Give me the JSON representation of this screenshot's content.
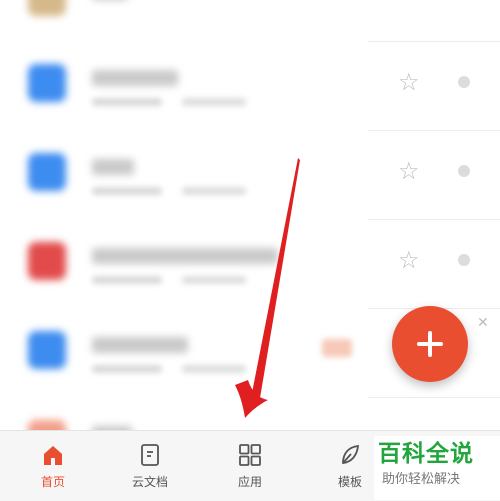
{
  "rows": [
    {
      "icon_color": "#a8a8a8",
      "starred": false
    },
    {
      "icon_color": "#3d8cf0",
      "starred": true
    },
    {
      "icon_color": "#3d8cf0",
      "starred": true
    },
    {
      "icon_color": "#e24b4b",
      "starred": true
    },
    {
      "icon_color": "#3d8cf0",
      "starred": false
    },
    {
      "icon_color": "#f2a08a",
      "starred": false
    }
  ],
  "fab": {
    "icon": "plus-icon",
    "color": "#e94e31"
  },
  "tabs": [
    {
      "label": "首页",
      "icon": "home-icon",
      "active": true
    },
    {
      "label": "云文档",
      "icon": "document-icon",
      "active": false
    },
    {
      "label": "应用",
      "icon": "grid-icon",
      "active": false
    },
    {
      "label": "模板",
      "icon": "leaf-icon",
      "active": false
    }
  ],
  "watermark": {
    "title": "百科全说",
    "subtitle": "助你轻松解决"
  },
  "arrow": {
    "color": "#e02020"
  }
}
